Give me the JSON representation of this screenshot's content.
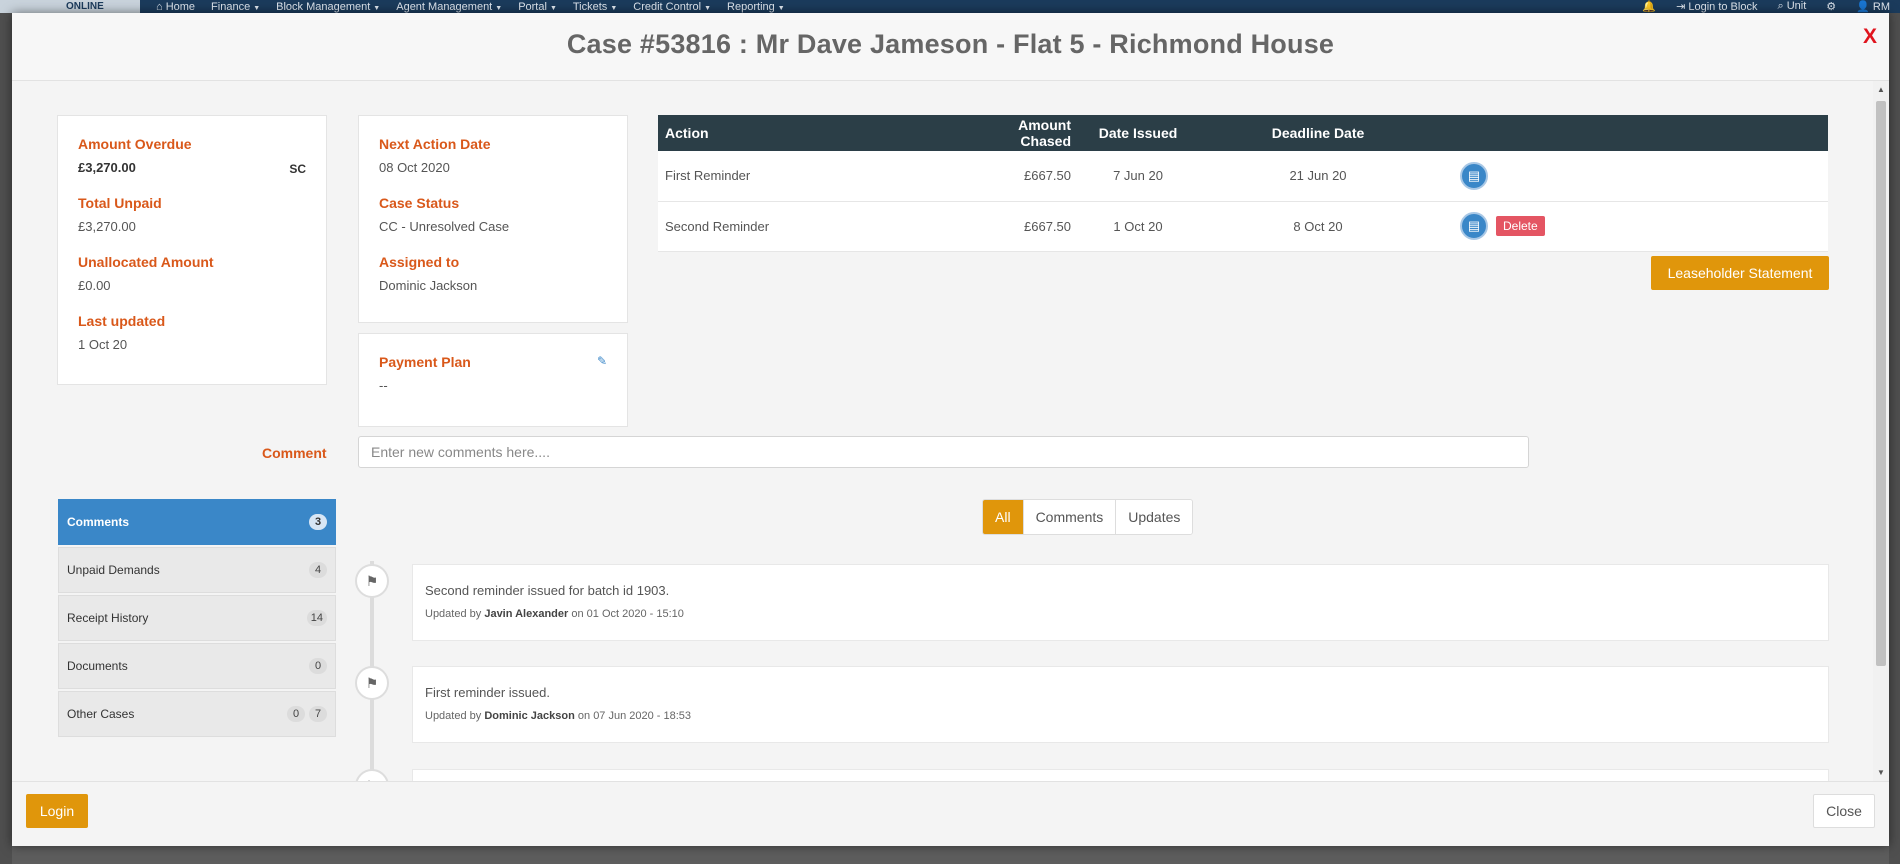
{
  "topnav": {
    "logo_text": "ONLINE",
    "items": [
      "Home",
      "Finance",
      "Block Management",
      "Agent Management",
      "Portal",
      "Tickets",
      "Credit Control",
      "Reporting"
    ],
    "right_items": [
      "Login to Block",
      "Unit",
      "RM"
    ]
  },
  "modal": {
    "title": "Case #53816 : Mr Dave Jameson - Flat 5 - Richmond House",
    "close_x": "X"
  },
  "summary": {
    "amount_overdue_label": "Amount Overdue",
    "amount_overdue_value": "£3,270.00",
    "amount_overdue_tag": "SC",
    "total_unpaid_label": "Total Unpaid",
    "total_unpaid_value": "£3,270.00",
    "unallocated_label": "Unallocated Amount",
    "unallocated_value": "£0.00",
    "last_updated_label": "Last updated",
    "last_updated_value": "1 Oct 20"
  },
  "case_info": {
    "next_action_label": "Next Action Date",
    "next_action_value": "08 Oct 2020",
    "status_label": "Case Status",
    "status_value": "CC - Unresolved Case",
    "assigned_label": "Assigned to",
    "assigned_value": "Dominic Jackson"
  },
  "payment_plan": {
    "label": "Payment Plan",
    "value": "--"
  },
  "actions_table": {
    "headers": [
      "Action",
      "Amount Chased",
      "Date Issued",
      "Deadline Date"
    ],
    "rows": [
      {
        "action": "First Reminder",
        "amount": "£667.50",
        "issued": "7 Jun 20",
        "deadline": "21 Jun 20"
      },
      {
        "action": "Second Reminder",
        "amount": "£667.50",
        "issued": "1 Oct 20",
        "deadline": "8 Oct 20",
        "delete_label": "Delete"
      }
    ]
  },
  "leaseholder_button": "Leaseholder Statement",
  "comment": {
    "label": "Comment",
    "placeholder": "Enter new comments here...."
  },
  "sidebar": {
    "items": [
      {
        "label": "Comments",
        "badges": [
          "3"
        ]
      },
      {
        "label": "Unpaid Demands",
        "badges": [
          "4"
        ]
      },
      {
        "label": "Receipt History",
        "badges": [
          "14"
        ]
      },
      {
        "label": "Documents",
        "badges": [
          "0"
        ]
      },
      {
        "label": "Other Cases",
        "badges": [
          "0",
          "7"
        ]
      }
    ]
  },
  "filter": {
    "all": "All",
    "comments": "Comments",
    "updates": "Updates"
  },
  "timeline": [
    {
      "message": "Second reminder issued for batch id 1903.",
      "prefix": "Updated by",
      "user": "Javin Alexander",
      "on": "on",
      "datetime": "01 Oct 2020 - 15:10"
    },
    {
      "message": "First reminder issued.",
      "prefix": "Updated by",
      "user": "Dominic Jackson",
      "on": "on",
      "datetime": "07 Jun 2020 - 18:53"
    }
  ],
  "footer": {
    "login": "Login",
    "close": "Close"
  }
}
